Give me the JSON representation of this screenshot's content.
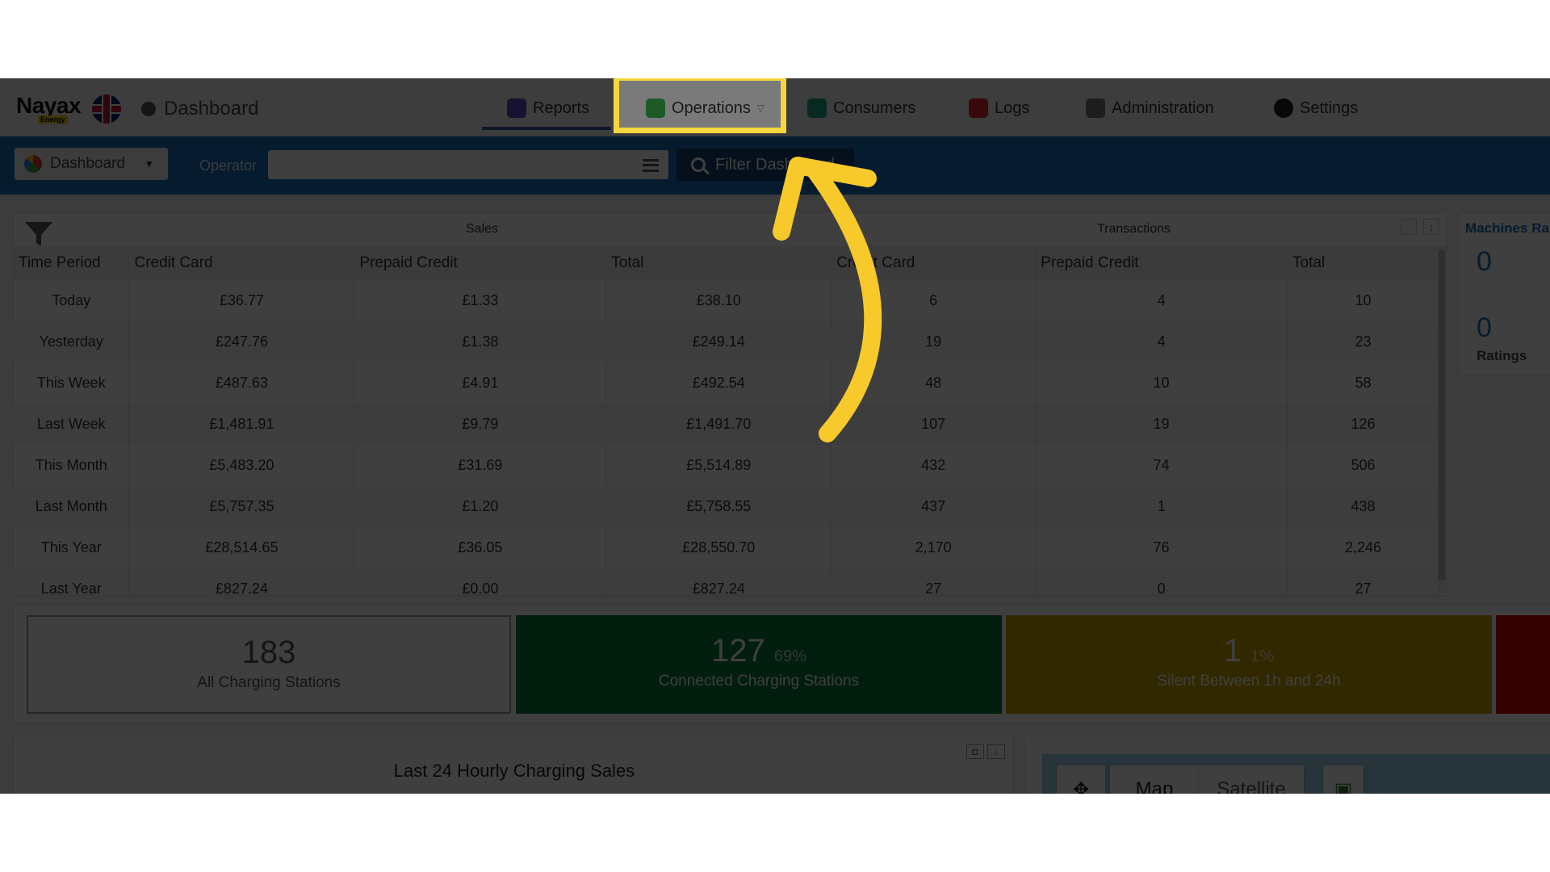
{
  "header": {
    "logo_text": "Nayax",
    "logo_sub": "Energy",
    "page_title": "Dashboard"
  },
  "nav": {
    "reports": "Reports",
    "operations": "Operations",
    "consumers": "Consumers",
    "logs": "Logs",
    "administration": "Administration",
    "settings": "Settings"
  },
  "filterbar": {
    "dashboard_dropdown": "Dashboard",
    "operator_label": "Operator",
    "operator_value": "",
    "filter_button": "Filter Dashboard"
  },
  "sales_table": {
    "group_sales": "Sales",
    "group_transactions": "Transactions",
    "columns": [
      "Time Period",
      "Credit Card",
      "Prepaid Credit",
      "Total",
      "Credit Card",
      "Prepaid Credit",
      "Total"
    ],
    "rows": [
      [
        "Today",
        "£36.77",
        "£1.33",
        "£38.10",
        "6",
        "4",
        "10"
      ],
      [
        "Yesterday",
        "£247.76",
        "£1.38",
        "£249.14",
        "19",
        "4",
        "23"
      ],
      [
        "This Week",
        "£487.63",
        "£4.91",
        "£492.54",
        "48",
        "10",
        "58"
      ],
      [
        "Last Week",
        "£1,481.91",
        "£9.79",
        "£1,491.70",
        "107",
        "19",
        "126"
      ],
      [
        "This Month",
        "£5,483.20",
        "£31.69",
        "£5,514.89",
        "432",
        "74",
        "506"
      ],
      [
        "Last Month",
        "£5,757.35",
        "£1.20",
        "£5,758.55",
        "437",
        "1",
        "438"
      ],
      [
        "This Year",
        "£28,514.65",
        "£36.05",
        "£28,550.70",
        "2,170",
        "76",
        "2,246"
      ],
      [
        "Last Year",
        "£827.24",
        "£0.00",
        "£827.24",
        "27",
        "0",
        "27"
      ]
    ]
  },
  "machines_panel": {
    "title": "Machines Ra",
    "value1": "0",
    "value2": "0",
    "label2": "Ratings"
  },
  "stations": {
    "all": {
      "count": "183",
      "label": "All Charging Stations"
    },
    "connected": {
      "count": "127",
      "pct": "69%",
      "label": "Connected Charging Stations"
    },
    "silent": {
      "count": "1",
      "pct": "1%",
      "label": "Silent Between 1h and 24h"
    }
  },
  "chart": {
    "title": "Last 24 Hourly Charging Sales"
  },
  "map": {
    "map_button": "Map",
    "satellite_button": "Satellite"
  },
  "colors": {
    "highlight": "#f5d63f",
    "arrow": "#f8c92a",
    "connected": "#0a7a3a",
    "silent": "#c8a200",
    "offline": "#d00000",
    "filterbar": "#1a6fb8"
  }
}
